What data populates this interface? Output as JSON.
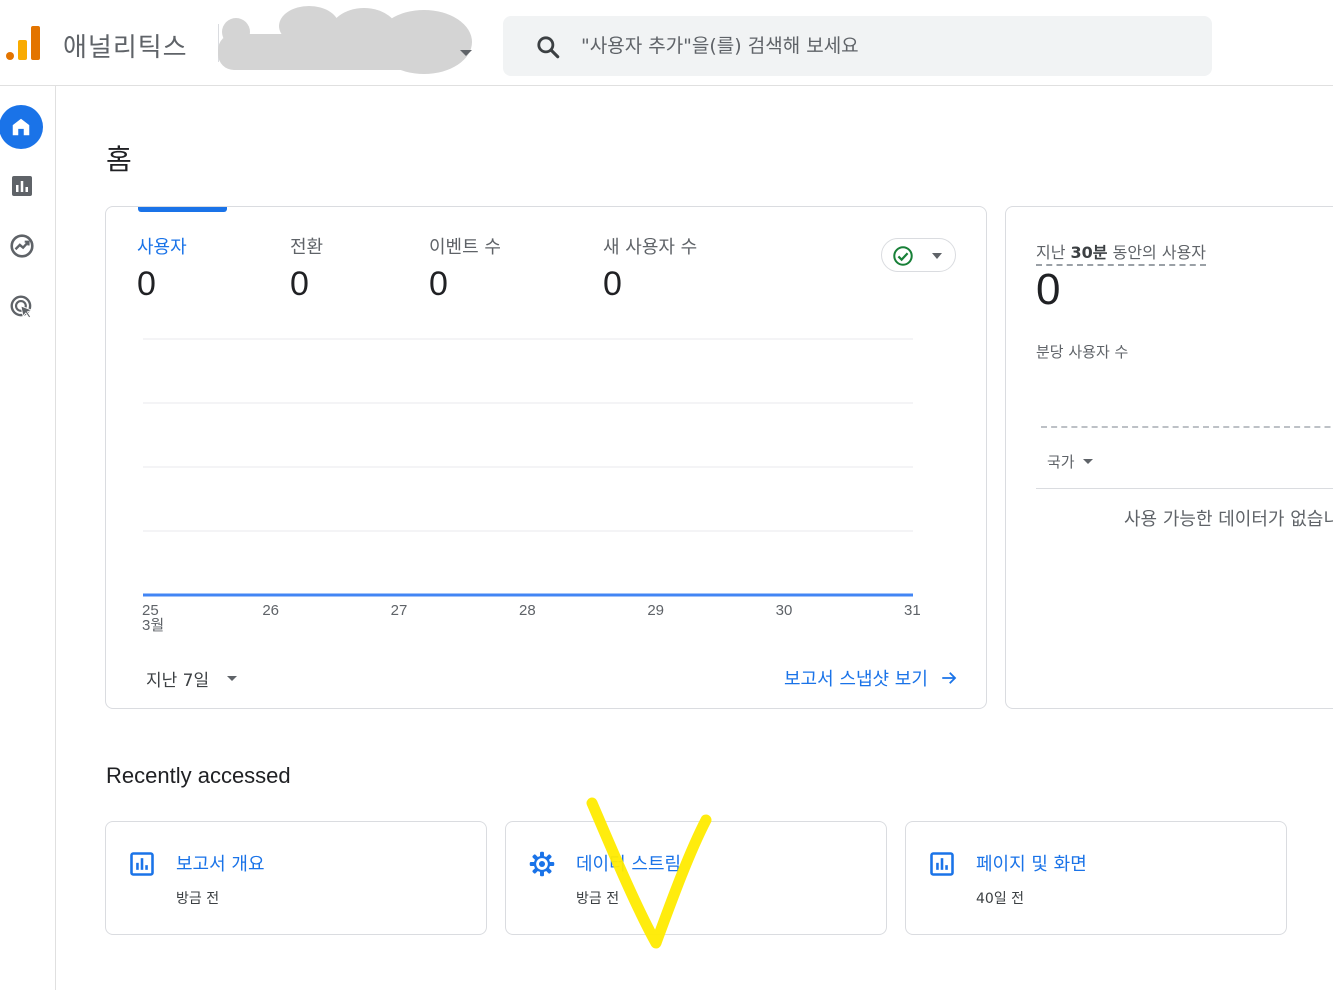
{
  "header": {
    "app_title": "애널리틱스",
    "search_placeholder": "\"사용자 추가\"을(를) 검색해 보세요"
  },
  "nav": {
    "items": [
      "home",
      "reports",
      "explore",
      "advertising"
    ]
  },
  "page": {
    "title": "홈"
  },
  "overview_card": {
    "metrics": [
      {
        "label": "사용자",
        "value": "0"
      },
      {
        "label": "전환",
        "value": "0"
      },
      {
        "label": "이벤트 수",
        "value": "0"
      },
      {
        "label": "새 사용자 수",
        "value": "0"
      }
    ],
    "date_range": "지난 7일",
    "snapshot_link": "보고서 스냅샷 보기"
  },
  "chart_data": {
    "type": "line",
    "x": [
      "25",
      "26",
      "27",
      "28",
      "29",
      "30",
      "31"
    ],
    "x_sublabel": "3월",
    "series": [
      {
        "values": [
          0,
          0,
          0,
          0,
          0,
          0,
          0
        ]
      }
    ],
    "grid": true,
    "color": "#4285f4"
  },
  "realtime_card": {
    "title_prefix": "지난 ",
    "title_bold": "30분",
    "title_suffix": " 동안의 사용자",
    "value": "0",
    "subtitle": "분당 사용자 수",
    "dimension": "국가",
    "empty_message": "사용 가능한 데이터가 없습니다"
  },
  "recent": {
    "title": "Recently accessed",
    "items": [
      {
        "icon": "bar-chart-icon",
        "title": "보고서 개요",
        "time": "방금 전"
      },
      {
        "icon": "gear-icon",
        "title": "데이터 스트림",
        "time": "방금 전"
      },
      {
        "icon": "bar-chart-icon",
        "title": "페이지 및 화면",
        "time": "40일 전"
      }
    ]
  },
  "colors": {
    "accent": "#1a73e8",
    "logo_orange": "#f9ab00",
    "logo_dark_orange": "#e37400",
    "annotation": "#ffeb00"
  }
}
